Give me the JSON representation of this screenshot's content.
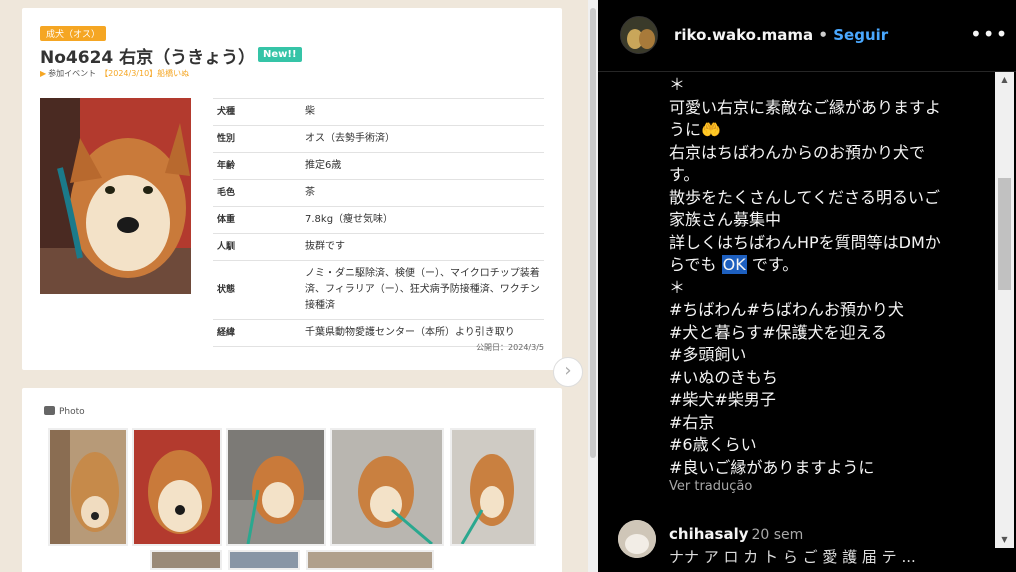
{
  "listing": {
    "tag": "成犬（オス）",
    "title": "No4624 右京（うきょう）",
    "new_badge": "New!!",
    "event_label": "参加イベント",
    "event_value": "【2024/3/10】船橋いぬ",
    "rows": [
      {
        "k": "犬種",
        "v": "柴"
      },
      {
        "k": "性別",
        "v": "オス（去勢手術済）"
      },
      {
        "k": "年齢",
        "v": "推定6歳"
      },
      {
        "k": "毛色",
        "v": "茶"
      },
      {
        "k": "体重",
        "v": "7.8kg（痩せ気味）"
      },
      {
        "k": "人馴",
        "v": "抜群です"
      },
      {
        "k": "状態",
        "v": "ノミ・ダニ駆除済、検便（ー）、マイクロチップ装着済、フィラリア（ー）、狂犬病予防接種済、ワクチン接種済"
      },
      {
        "k": "経緯",
        "v": "千葉県動物愛護センター（本所）より引き取り"
      }
    ],
    "published": "公開日：2024/3/5",
    "photo_label": "Photo",
    "next_icon": "chevron-right-icon"
  },
  "instagram": {
    "username": "riko.wako.mama",
    "separator": "•",
    "follow": "Seguir",
    "more": "•••",
    "caption": {
      "l1": "＊",
      "l2": "可愛い右京に素敵なご縁がありますよ",
      "l3": "うに🤲",
      "l4": "右京はちばわんからのお預かり犬で",
      "l5": "す。",
      "l6": "散歩をたくさんしてくださる明るいご",
      "l7": "家族さん募集中",
      "l8": "詳しくはちばわんHPを質問等はDMか",
      "l9a": "らでも",
      "l9b": "OK",
      "l9c": "です。",
      "l10": "＊",
      "l11": "#ちばわん#ちばわんお預かり犬",
      "l12": "#犬と暮らす#保護犬を迎える",
      "l13": "#多頭飼い",
      "l14": "#いぬのきもち",
      "l15": "#柴犬#柴男子",
      "l16": "#右京",
      "l17": "#6歳くらい",
      "l18": "#良いご縁がありますように"
    },
    "translate": "Ver tradução",
    "comment": {
      "user": "chihasaly",
      "time": "20 sem",
      "text": "ナナ ア ロ カ ト ら ご 愛 護 届 テ ..."
    }
  }
}
